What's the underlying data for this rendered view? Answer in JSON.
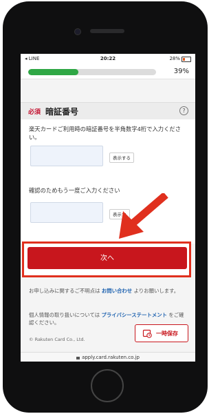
{
  "status": {
    "carrier": "◂ LINE",
    "time": "20:22",
    "battery": "28%"
  },
  "progress": {
    "percent_label": "39%",
    "fraction": 0.39
  },
  "section": {
    "required": "必須",
    "title": "暗証番号",
    "help": "?"
  },
  "form": {
    "description": "楽天カードご利用時の暗証番号を半角数字4桁で入力ください。",
    "show_label": "表示する",
    "confirm_label": "確認のためもう一度ご入力ください",
    "show_label_2": "表示す"
  },
  "next_button": "次へ",
  "footer": {
    "inquiry_prefix": "お申し込みに関するご不明点は",
    "inquiry_link": "お問い合わせ",
    "inquiry_suffix": "よりお願いします。",
    "privacy_prefix": "個人情報の取り扱いについては",
    "privacy_link": "プライバシーステートメント",
    "privacy_suffix": "をご確認ください。",
    "copyright": "© Rakuten Card Co., Ltd.",
    "save_button": "一時保存"
  },
  "url": "apply.card.rakuten.co.jp",
  "colors": {
    "brand_red": "#c8161d",
    "progress_green": "#2fa745",
    "link_blue": "#1f63b0",
    "annotation_red": "#e0301e"
  }
}
